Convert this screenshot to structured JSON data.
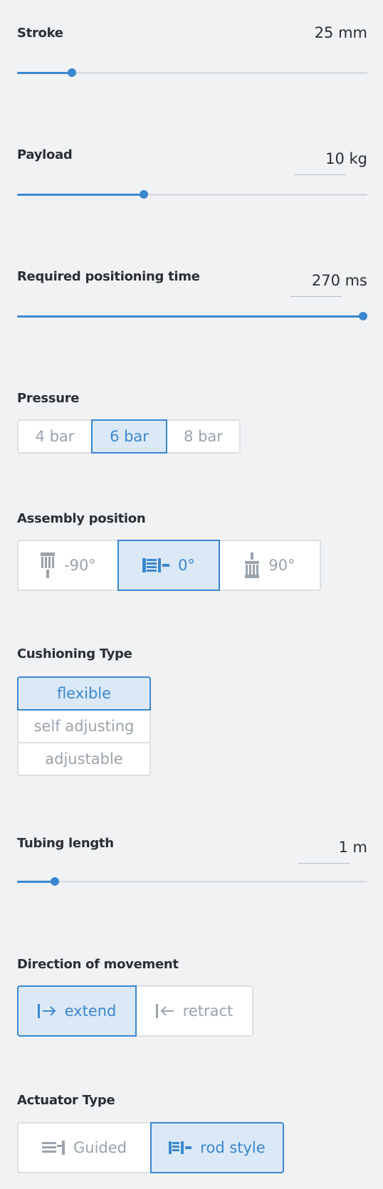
{
  "stroke": {
    "label": "Stroke",
    "value": "25 mm",
    "fraction": 0.157
  },
  "payload": {
    "label": "Payload",
    "value": "10 kg",
    "fraction": 0.361
  },
  "positioning_time": {
    "label": "Required positioning time",
    "value": "270 ms",
    "fraction": 1.0
  },
  "pressure": {
    "label": "Pressure",
    "options": [
      "4 bar",
      "6 bar",
      "8 bar"
    ],
    "selected": "6 bar"
  },
  "assembly": {
    "label": "Assembly position",
    "options": [
      {
        "label": "-90°",
        "icon": "vertical-down-mount-icon"
      },
      {
        "label": "0°",
        "icon": "horizontal-mount-icon"
      },
      {
        "label": "90°",
        "icon": "vertical-up-mount-icon"
      }
    ],
    "selected": "0°"
  },
  "cushioning": {
    "label": "Cushioning Type",
    "options": [
      "flexible",
      "self adjusting",
      "adjustable"
    ],
    "selected": "flexible"
  },
  "tubing": {
    "label": "Tubing length",
    "value": "1 m",
    "fraction": 0.107
  },
  "direction": {
    "label": "Direction of movement",
    "options": [
      {
        "label": "extend",
        "icon": "extend-arrow-icon"
      },
      {
        "label": "retract",
        "icon": "retract-arrow-icon"
      }
    ],
    "selected": "extend"
  },
  "actuator": {
    "label": "Actuator Type",
    "options": [
      {
        "label": "Guided",
        "icon": "guided-actuator-icon"
      },
      {
        "label": "rod style",
        "icon": "rod-style-actuator-icon"
      }
    ],
    "selected": "rod style"
  },
  "colors": {
    "accent": "#3b87cf",
    "selected_bg": "#dbe9f6",
    "track": "#dadde1",
    "background": "#f1f2f4"
  }
}
